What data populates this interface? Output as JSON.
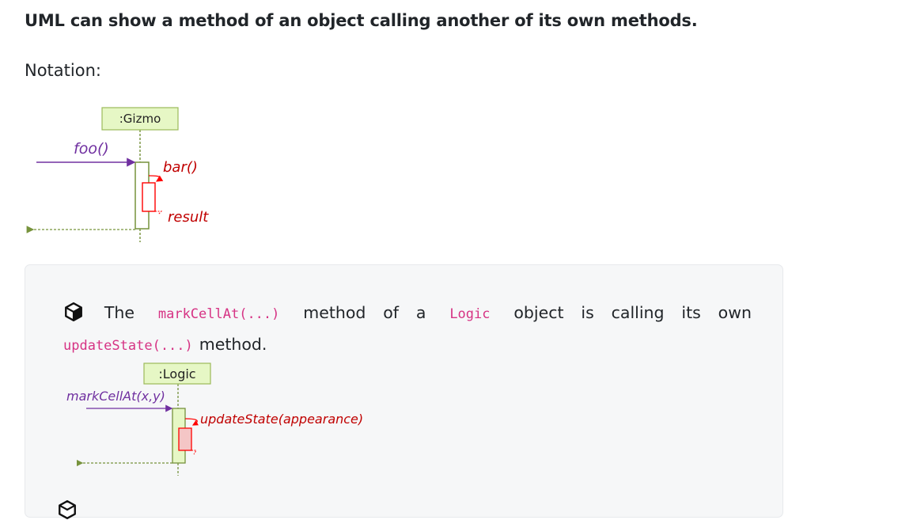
{
  "heading": "UML can show a method of an object calling another of its own methods.",
  "notation_label": "Notation:",
  "notation_diagram": {
    "object_name": ":Gizmo",
    "incoming_call": "foo()",
    "self_call": "bar()",
    "return_label": "result"
  },
  "example": {
    "text_before": "The",
    "code_method": "markCellAt(...)",
    "text_middle_1": "method of a",
    "code_class": "Logic",
    "text_middle_2": "object is calling its own",
    "code_callee": "updateState(...)",
    "text_after": "method.",
    "diagram": {
      "object_name": ":Logic",
      "incoming_call": "markCellAt(x,y)",
      "self_call": "updateState(appearance)"
    }
  },
  "icons": [
    "box-icon",
    "box-icon"
  ],
  "colors": {
    "object_fill": "#e6f7c5",
    "object_border": "#9bbb59",
    "lifeline_green": "#76923c",
    "call_arrow": "#7030a0",
    "self_call": "#ff0000",
    "return_arrow": "#77933c",
    "code_text": "#d63384"
  }
}
